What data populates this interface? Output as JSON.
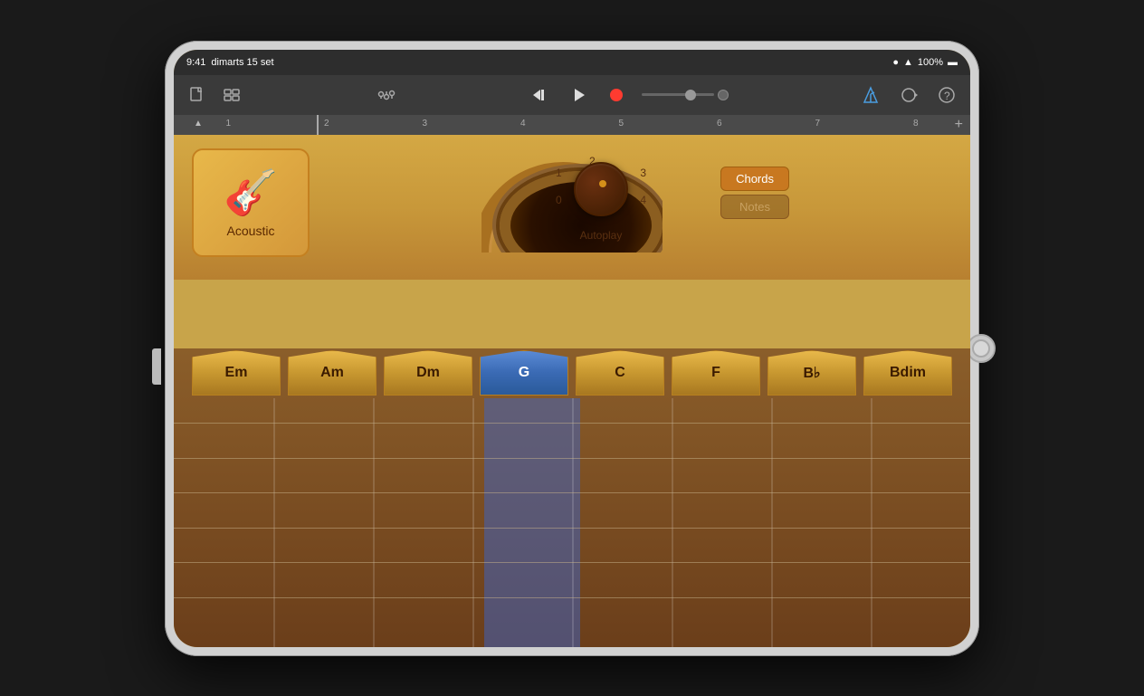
{
  "device": {
    "status_bar": {
      "time": "9:41",
      "date": "dimarts 15 set",
      "battery": "100%"
    }
  },
  "toolbar": {
    "new_song_label": "📄",
    "tracks_label": "⊞",
    "mixer_label": "🎚",
    "rewind_label": "⏮",
    "play_label": "▶",
    "record_label": "⏺",
    "metronome_label": "🔔",
    "loop_label": "↻",
    "help_label": "?"
  },
  "ruler": {
    "marks": [
      "1",
      "2",
      "3",
      "4",
      "5",
      "6",
      "7",
      "8"
    ],
    "plus_label": "+"
  },
  "instrument": {
    "name": "Acoustic",
    "icon": "🎸"
  },
  "autoplay": {
    "label": "Autoplay",
    "knob_positions": [
      "0",
      "1",
      "2",
      "3",
      "4"
    ]
  },
  "mode_buttons": {
    "chords_label": "Chords",
    "notes_label": "Notes",
    "active": "chords"
  },
  "chord_buttons": [
    {
      "label": "Em",
      "active": false
    },
    {
      "label": "Am",
      "active": false
    },
    {
      "label": "Dm",
      "active": false
    },
    {
      "label": "G",
      "active": true
    },
    {
      "label": "C",
      "active": false
    },
    {
      "label": "F",
      "active": false
    },
    {
      "label": "B♭",
      "active": false
    },
    {
      "label": "Bdim",
      "active": false
    }
  ],
  "strings": {
    "count": 6
  }
}
